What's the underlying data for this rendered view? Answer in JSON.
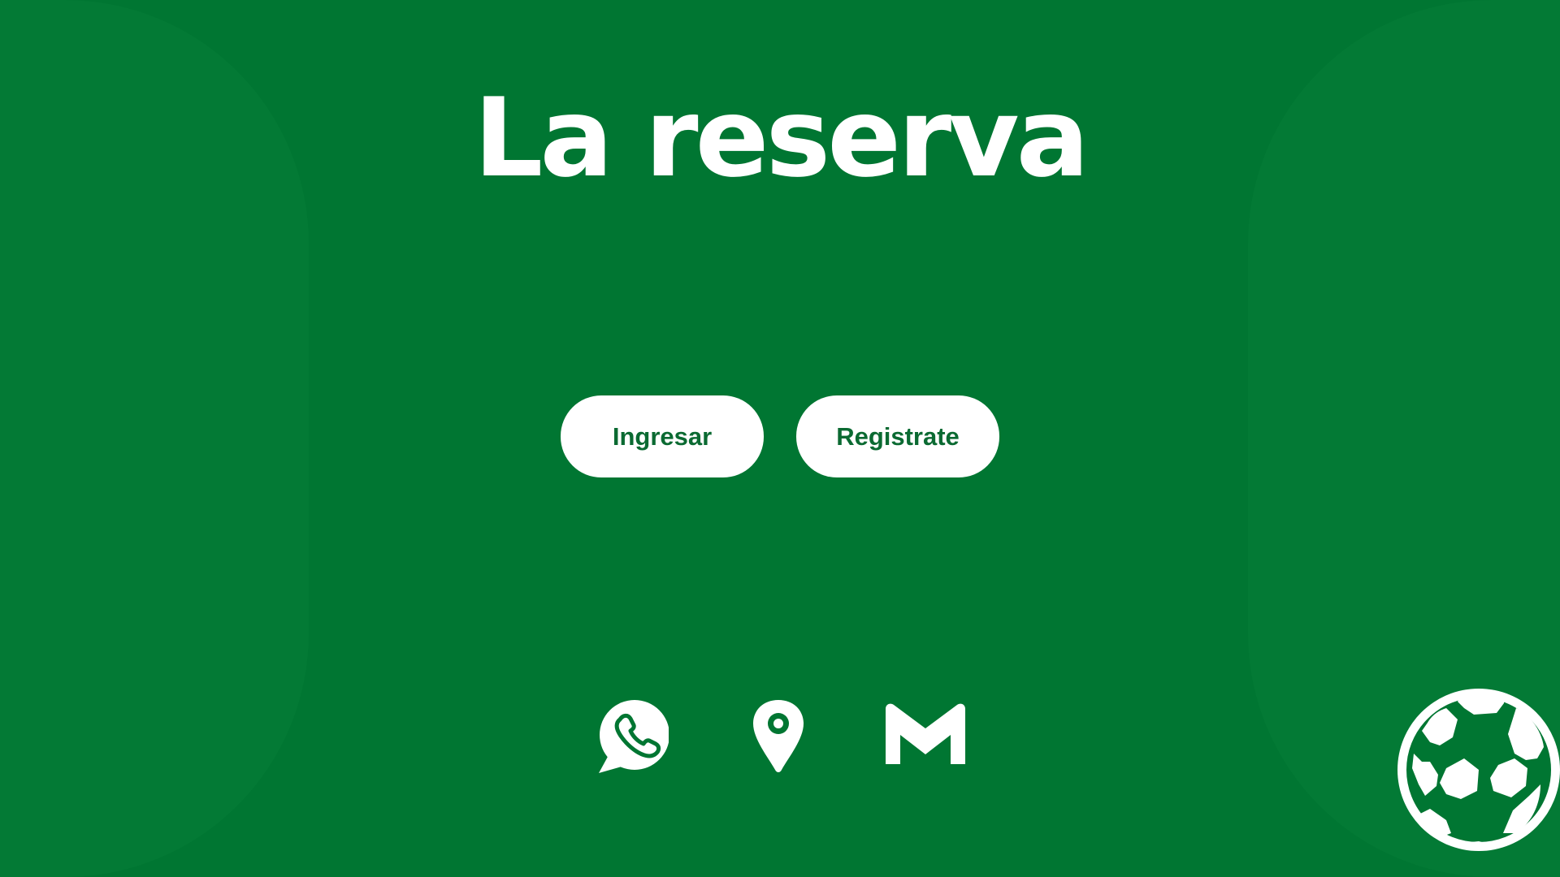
{
  "app": {
    "title": "La reserva"
  },
  "buttons": {
    "login_label": "Ingresar",
    "register_label": "Registrate"
  },
  "contact_icons": [
    "whatsapp-icon",
    "location-pin-icon",
    "mail-icon"
  ],
  "decoration": {
    "ball_icon": "soccer-ball-icon"
  },
  "colors": {
    "background": "#007632",
    "side_shapes": "#037a35",
    "text_on_bg": "#ffffff",
    "button_bg": "#ffffff",
    "button_text": "#0b6a32"
  }
}
